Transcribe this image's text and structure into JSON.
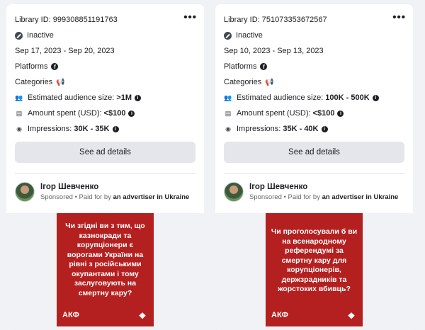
{
  "cards": [
    {
      "library_id": "Library ID: 999308851191763",
      "status": "Inactive",
      "dates": "Sep 17, 2023 - Sep 20, 2023",
      "platforms_label": "Platforms",
      "categories_label": "Categories",
      "audience_label": "Estimated audience size:",
      "audience_value": ">1M",
      "spent_label": "Amount spent (USD):",
      "spent_value": "<$100",
      "impressions_label": "Impressions:",
      "impressions_value": "30K - 35K",
      "details_button": "See ad details",
      "advertiser_name": "Ігор Шевченко",
      "sponsored": "Sponsored",
      "paid_by_prefix": " • Paid for by ",
      "paid_by": "an advertiser in Ukraine",
      "poster_text": "Чи згідні ви з тим, що казнокради та корупціонери є ворогами України на рівні з російськими окупантами і тому заслуговують на смертну кару?",
      "poster_brand": "АКФ"
    },
    {
      "library_id": "Library ID: 751073353672567",
      "status": "Inactive",
      "dates": "Sep 10, 2023 - Sep 13, 2023",
      "platforms_label": "Platforms",
      "categories_label": "Categories",
      "audience_label": "Estimated audience size:",
      "audience_value": "100K - 500K",
      "spent_label": "Amount spent (USD):",
      "spent_value": "<$100",
      "impressions_label": "Impressions:",
      "impressions_value": "35K - 40K",
      "details_button": "See ad details",
      "advertiser_name": "Ігор Шевченко",
      "sponsored": "Sponsored",
      "paid_by_prefix": " • Paid for by ",
      "paid_by": "an advertiser in Ukraine",
      "poster_text": "Чи проголосували б ви на всенародному референдумі за смертну кару для корупціонерів, держзрадників та жорстоких вбивць?",
      "poster_brand": "АКФ"
    }
  ],
  "icons": {
    "more": "•••",
    "facebook": "f",
    "megaphone": "📢",
    "people": "👥",
    "money": "▤",
    "eye": "◉",
    "info": "i",
    "ornament": "❖"
  },
  "colors": {
    "poster_red": "#b3201f",
    "button_gray": "#e4e6eb"
  }
}
